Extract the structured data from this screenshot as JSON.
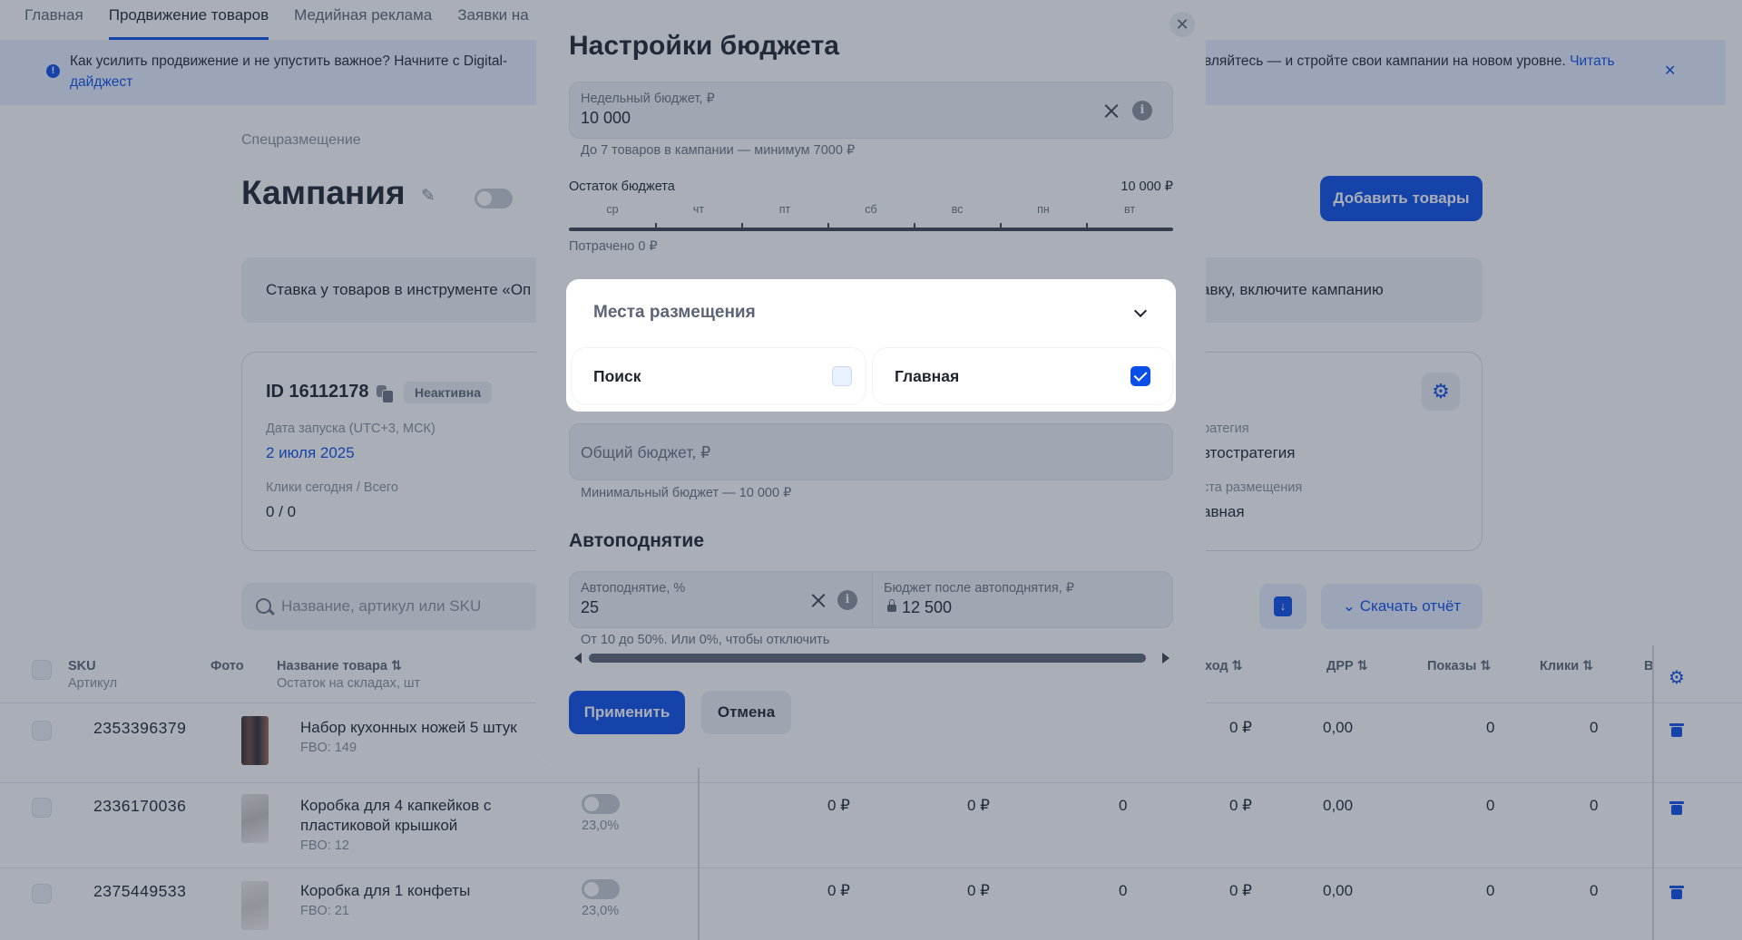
{
  "colors": {
    "accent": "#0a4ee8",
    "overlay": "rgba(40,52,74,0.40)",
    "muted_text": "#6b7280",
    "field_bg": "#f2f4f7"
  },
  "nav": {
    "tabs": [
      {
        "label": "Главная",
        "active": false
      },
      {
        "label": "Продвижение товаров",
        "active": true
      },
      {
        "label": "Медийная реклама",
        "active": false
      },
      {
        "label": "Заявки на",
        "active": false
      }
    ]
  },
  "banner": {
    "text_left": "Как усилить продвижение и не упустить важное? Начните с Digital-",
    "text_right": "вляйтесь — и стройте свои кампании на новом уровне.",
    "link_part1": "Читать",
    "link_part2": "дайджест",
    "close_icon": "close-icon"
  },
  "page": {
    "breadcrumb": "Спецразмещение",
    "title": "Кампания",
    "add_button": "Добавить товары",
    "notice_left": "Ставка у товаров в инструменте «Оп",
    "notice_right": "авку, включите кампанию"
  },
  "campaign_card": {
    "id": "ID 16112178",
    "status": "Неактивна",
    "launch_label": "Дата запуска (UTC+3, МСК)",
    "launch_value": "2 июля 2025",
    "clicks_label": "Клики сегодня / Всего",
    "clicks_value": "0 / 0",
    "strategy_label": "ратегия",
    "strategy_value": "втостратегия",
    "placement_label": "ста размещения",
    "placement_value": "авная"
  },
  "toolbar": {
    "search_placeholder": "Название, артикул или SKU",
    "report_button": "Скачать отчёт"
  },
  "table": {
    "headers": {
      "sku": "SKU",
      "sku_sub": "Артикул",
      "photo": "Фото",
      "name": "Название товара ⇅",
      "name_sub": "Остаток на складах, шт",
      "expense": "ход ⇅",
      "drr": "ДРР ⇅",
      "views": "Показы ⇅",
      "clicks": "Клики ⇅",
      "more": "В"
    },
    "rows": [
      {
        "sku": "2353396379",
        "name": "Набор кухонных ножей 5 штук",
        "name2": "",
        "stock": "FBO: 149",
        "rate": "",
        "c1": "",
        "c2": "",
        "c3": "",
        "expense": "0 ₽",
        "drr": "0,00",
        "views": "0",
        "clicks": "0"
      },
      {
        "sku": "2336170036",
        "name": "Коробка для 4 капкейков с",
        "name2": "пластиковой крышкой",
        "stock": "FBO: 12",
        "rate": "23,0%",
        "c1": "0 ₽",
        "c2": "0 ₽",
        "c3": "0",
        "expense": "0 ₽",
        "drr": "0,00",
        "views": "0",
        "clicks": "0"
      },
      {
        "sku": "2375449533",
        "name": "Коробка для 1 конфеты",
        "name2": "",
        "stock": "FBO: 21",
        "rate": "23,0%",
        "c1": "0 ₽",
        "c2": "0 ₽",
        "c3": "0",
        "expense": "0 ₽",
        "drr": "0,00",
        "views": "0",
        "clicks": "0"
      }
    ]
  },
  "modal": {
    "title": "Настройки бюджета",
    "close_icon": "close-icon",
    "weekly_label": "Недельный бюджет, ₽",
    "weekly_value": "10 000",
    "weekly_hint": "До 7 товаров в кампании — минимум 7000 ₽",
    "remaining_label": "Остаток бюджета",
    "remaining_value": "10 000 ₽",
    "days": [
      "ср",
      "чт",
      "пт",
      "сб",
      "вс",
      "пн",
      "вт"
    ],
    "spent": "Потрачено 0 ₽",
    "placement_title": "Места размещения",
    "placement_options": [
      {
        "label": "Поиск",
        "checked": false
      },
      {
        "label": "Главная",
        "checked": true
      }
    ],
    "total_placeholder": "Общий бюджет, ₽",
    "total_hint": "Минимальный бюджет — 10 000 ₽",
    "autoraise_title": "Автоподнятие",
    "autoraise_label": "Автоподнятие, %",
    "autoraise_value": "25",
    "after_label": "Бюджет после автоподнятия, ₽",
    "after_value": "12 500",
    "autoraise_hint": "От 10 до 50%. Или 0%, чтобы отключить",
    "apply": "Применить",
    "cancel": "Отмена"
  }
}
